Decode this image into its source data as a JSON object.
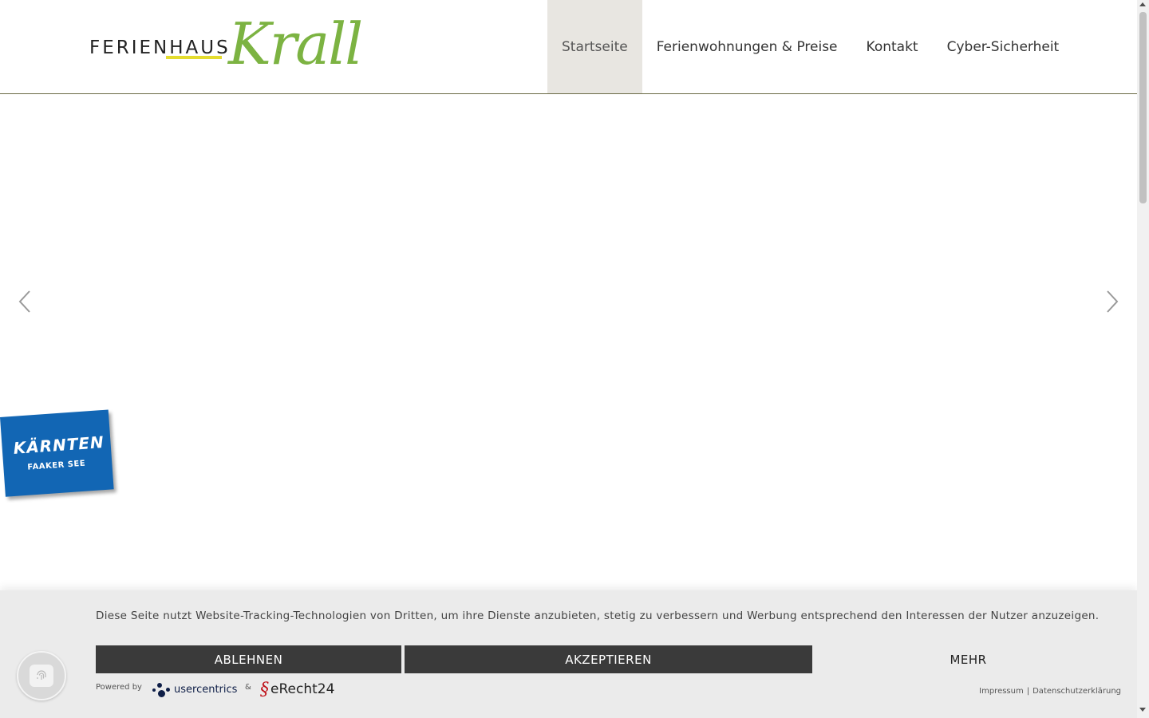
{
  "header": {
    "logo": {
      "word": "FERIENHAUS",
      "script": "Krall"
    },
    "nav": [
      {
        "label": "Startseite",
        "active": true
      },
      {
        "label": "Ferienwohnungen & Preise",
        "active": false
      },
      {
        "label": "Kontakt",
        "active": false
      },
      {
        "label": "Cyber-Sicherheit",
        "active": false
      }
    ]
  },
  "slider": {
    "prev_icon": "chevron-left-icon",
    "next_icon": "chevron-right-icon",
    "badge": {
      "title": "KÄRNTEN",
      "subtitle": "FAAKER SEE"
    }
  },
  "cookie": {
    "text": "Diese Seite nutzt Website-Tracking-Technologien von Dritten, um ihre Dienste anzubieten, stetig zu verbessern und Werbung entsprechend den Interessen der Nutzer anzuzeigen.",
    "decline_label": "ABLEHNEN",
    "accept_label": "AKZEPTIEREN",
    "more_label": "MEHR",
    "powered_by": "Powered by",
    "usercentrics": "usercentrics",
    "ampersand": "&",
    "erecht": "eRecht24",
    "impressum": "Impressum",
    "separator": "|",
    "datenschutz": "Datenschutzerklärung"
  },
  "colors": {
    "accent_green": "#7cb342",
    "underline_yellow": "#e4dc2e",
    "badge_blue": "#1266b4",
    "button_dark": "#3a3a3a"
  }
}
